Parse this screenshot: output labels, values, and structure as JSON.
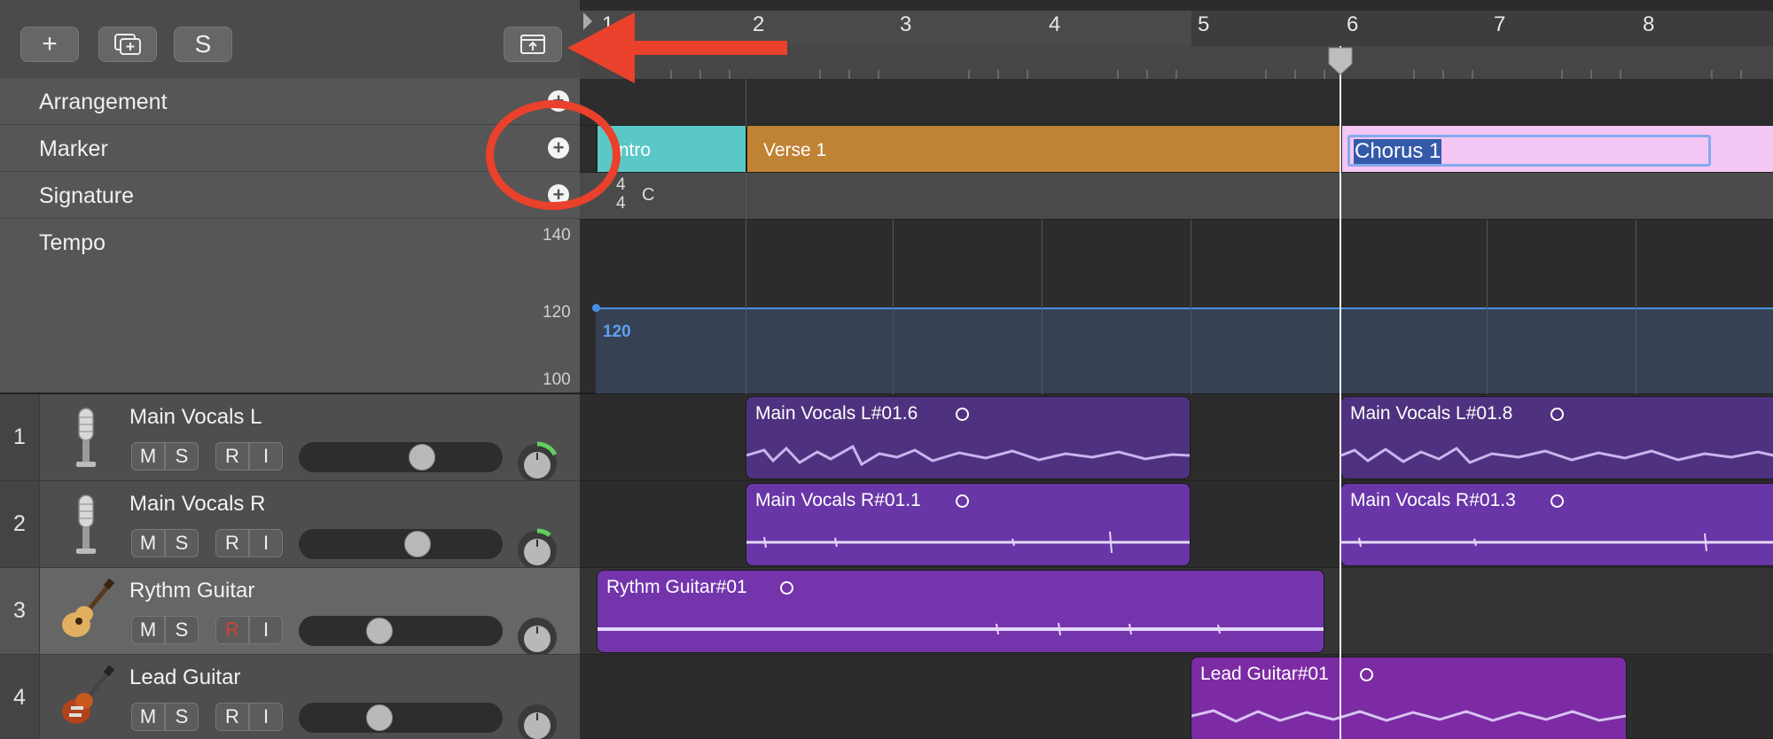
{
  "toolbar": {
    "add_label": "+",
    "solo_label": "S"
  },
  "global_tracks": [
    {
      "label": "Arrangement"
    },
    {
      "label": "Marker"
    },
    {
      "label": "Signature"
    },
    {
      "label": "Tempo"
    }
  ],
  "tempo": {
    "scale": [
      "140",
      "120",
      "100"
    ],
    "value_label": "120",
    "line_color": "#4a8ee8"
  },
  "signature": {
    "numerator": "4",
    "denominator": "4",
    "key": "C"
  },
  "ruler": {
    "bars": [
      "1",
      "2",
      "3",
      "4",
      "5",
      "6",
      "7",
      "8"
    ]
  },
  "markers": [
    {
      "name": "Intro",
      "color": "#5bc8c8"
    },
    {
      "name": "Verse 1",
      "color": "#c08234"
    },
    {
      "name": "Chorus 1",
      "color": "#f4c7f4",
      "editing": true
    }
  ],
  "tracks": [
    {
      "number": "1",
      "name": "Main Vocals L",
      "icon": "microphone-icon",
      "mute": "M",
      "solo": "S",
      "record": "R",
      "input": "I",
      "record_armed": false,
      "volume": 0.45,
      "pan_indicator": "green-arc"
    },
    {
      "number": "2",
      "name": "Main Vocals R",
      "icon": "microphone-icon",
      "mute": "M",
      "solo": "S",
      "record": "R",
      "input": "I",
      "record_armed": false,
      "volume": 0.43,
      "pan_indicator": "green-arc-small"
    },
    {
      "number": "3",
      "name": "Rythm Guitar",
      "icon": "acoustic-guitar-icon",
      "mute": "M",
      "solo": "S",
      "record": "R",
      "input": "I",
      "record_armed": true,
      "volume": 0.28,
      "pan_indicator": "center"
    },
    {
      "number": "4",
      "name": "Lead Guitar",
      "icon": "electric-guitar-icon",
      "mute": "M",
      "solo": "S",
      "record": "R",
      "input": "I",
      "record_armed": false,
      "volume": 0.28,
      "pan_indicator": "center"
    }
  ],
  "regions": [
    {
      "track": 1,
      "name": "Main Vocals L#01.6",
      "color": "#4e327f"
    },
    {
      "track": 1,
      "name": "Main Vocals L#01.8",
      "color": "#4e327f"
    },
    {
      "track": 2,
      "name": "Main Vocals R#01.1",
      "color": "#6836a6"
    },
    {
      "track": 2,
      "name": "Main Vocals R#01.3",
      "color": "#6836a6"
    },
    {
      "track": 3,
      "name": "Rythm Guitar#01",
      "color": "#7334ac"
    },
    {
      "track": 4,
      "name": "Lead Guitar#01",
      "color": "#7c2ba4"
    }
  ],
  "annotation": {
    "color": "#e9412b"
  }
}
